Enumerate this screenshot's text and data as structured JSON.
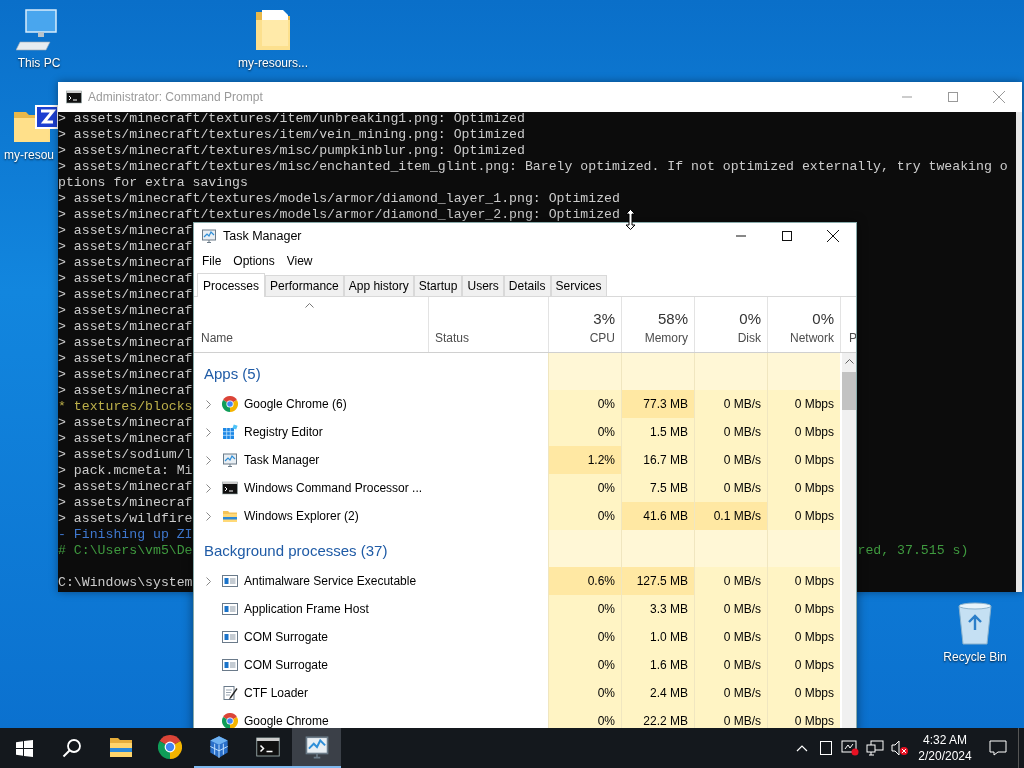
{
  "desktop_icons": [
    {
      "label": "This PC",
      "kind": "pc"
    },
    {
      "label": "my-resours...",
      "kind": "folder"
    },
    {
      "label": "my-resou",
      "kind": "zip"
    },
    {
      "label": "Recycle Bin",
      "kind": "recycle"
    }
  ],
  "console": {
    "title": "Administrator: Command Prompt",
    "lines": [
      {
        "kind": "output",
        "text": "> assets/minecraft/textures/item/unbreaking1.png: Optimized"
      },
      {
        "kind": "output",
        "text": "> assets/minecraft/textures/item/vein_mining.png: Optimized"
      },
      {
        "kind": "output",
        "text": "> assets/minecraft/textures/misc/pumpkinblur.png: Optimized"
      },
      {
        "kind": "output",
        "text": "> assets/minecraft/textures/misc/enchanted_item_glint.png: Barely optimized. If not optimized externally, try tweaking o"
      },
      {
        "kind": "output",
        "text": "ptions for extra savings"
      },
      {
        "kind": "output",
        "text": "> assets/minecraft/textures/models/armor/diamond_layer_1.png: Optimized"
      },
      {
        "kind": "output",
        "text": "> assets/minecraft/textures/models/armor/diamond_layer_2.png: Optimized"
      },
      {
        "kind": "output",
        "text": "> assets/minecraf"
      },
      {
        "kind": "output",
        "text": "> assets/minecraf"
      },
      {
        "kind": "output",
        "text": "> assets/minecraf"
      },
      {
        "kind": "output",
        "text": "> assets/minecraf"
      },
      {
        "kind": "output",
        "text": "> assets/minecraf"
      },
      {
        "kind": "output",
        "text": "> assets/minecraf"
      },
      {
        "kind": "output",
        "text": "> assets/minecraf"
      },
      {
        "kind": "output",
        "text": "> assets/minecraf"
      },
      {
        "kind": "output",
        "text": "> assets/minecraf"
      },
      {
        "kind": "output",
        "text": "> assets/minecraf"
      },
      {
        "kind": "output",
        "text": "> assets/minecraf"
      },
      {
        "kind": "warning",
        "text": "* textures/blocks"
      },
      {
        "kind": "output",
        "text": "> assets/minecraf"
      },
      {
        "kind": "output",
        "text": "> assets/minecraf"
      },
      {
        "kind": "output",
        "text": "> assets/sodium/l"
      },
      {
        "kind": "output",
        "text": "> pack.mcmeta: Mi"
      },
      {
        "kind": "output",
        "text": "> assets/minecraf"
      },
      {
        "kind": "output",
        "text": "> assets/minecraf"
      },
      {
        "kind": "output",
        "text": "> assets/wildfire"
      },
      {
        "kind": "info",
        "text": "- Finishing up ZI"
      },
      {
        "kind": "success",
        "text": "# C:\\Users\\vm5\\De",
        "tail": "red, 37.515 s)"
      },
      {
        "kind": "blank"
      },
      {
        "kind": "output",
        "text": "C:\\Windows\\system"
      }
    ]
  },
  "task_manager": {
    "title": "Task Manager",
    "menu": [
      "File",
      "Options",
      "View"
    ],
    "tabs": [
      {
        "label": "Processes",
        "selected": true
      },
      {
        "label": "Performance",
        "selected": false
      },
      {
        "label": "App history",
        "selected": false
      },
      {
        "label": "Startup",
        "selected": false
      },
      {
        "label": "Users",
        "selected": false
      },
      {
        "label": "Details",
        "selected": false
      },
      {
        "label": "Services",
        "selected": false
      }
    ],
    "columns": {
      "name": "Name",
      "status": "Status",
      "metrics": [
        {
          "percent": "3%",
          "label": "CPU"
        },
        {
          "percent": "58%",
          "label": "Memory"
        },
        {
          "percent": "0%",
          "label": "Disk"
        },
        {
          "percent": "0%",
          "label": "Network"
        }
      ],
      "cut_header": "P"
    },
    "groups": [
      {
        "title": "Apps (5)",
        "rows": [
          {
            "name": "Google Chrome (6)",
            "kind": "chrome",
            "expandable": true,
            "cells": [
              {
                "text": "0%",
                "hot": false
              },
              {
                "text": "77.3 MB",
                "hot": true
              },
              {
                "text": "0 MB/s",
                "hot": false
              },
              {
                "text": "0 Mbps",
                "hot": false
              }
            ]
          },
          {
            "name": "Registry Editor",
            "kind": "registry",
            "expandable": true,
            "cells": [
              {
                "text": "0%",
                "hot": false
              },
              {
                "text": "1.5 MB",
                "hot": false
              },
              {
                "text": "0 MB/s",
                "hot": false
              },
              {
                "text": "0 Mbps",
                "hot": false
              }
            ]
          },
          {
            "name": "Task Manager",
            "kind": "taskmgr",
            "expandable": true,
            "cells": [
              {
                "text": "1.2%",
                "hot": true
              },
              {
                "text": "16.7 MB",
                "hot": false
              },
              {
                "text": "0 MB/s",
                "hot": false
              },
              {
                "text": "0 Mbps",
                "hot": false
              }
            ]
          },
          {
            "name": "Windows Command Processor ...",
            "kind": "cmd",
            "expandable": true,
            "cells": [
              {
                "text": "0%",
                "hot": false
              },
              {
                "text": "7.5 MB",
                "hot": false
              },
              {
                "text": "0 MB/s",
                "hot": false
              },
              {
                "text": "0 Mbps",
                "hot": false
              }
            ]
          },
          {
            "name": "Windows Explorer (2)",
            "kind": "explorer",
            "expandable": true,
            "cells": [
              {
                "text": "0%",
                "hot": false
              },
              {
                "text": "41.6 MB",
                "hot": true
              },
              {
                "text": "0.1 MB/s",
                "hot": true
              },
              {
                "text": "0 Mbps",
                "hot": false
              }
            ]
          }
        ]
      },
      {
        "title": "Background processes (37)",
        "rows": [
          {
            "name": "Antimalware Service Executable",
            "kind": "service",
            "expandable": true,
            "cells": [
              {
                "text": "0.6%",
                "hot": true
              },
              {
                "text": "127.5 MB",
                "hot": true
              },
              {
                "text": "0 MB/s",
                "hot": false
              },
              {
                "text": "0 Mbps",
                "hot": false
              }
            ]
          },
          {
            "name": "Application Frame Host",
            "kind": "service",
            "expandable": false,
            "cells": [
              {
                "text": "0%",
                "hot": false
              },
              {
                "text": "3.3 MB",
                "hot": false
              },
              {
                "text": "0 MB/s",
                "hot": false
              },
              {
                "text": "0 Mbps",
                "hot": false
              }
            ]
          },
          {
            "name": "COM Surrogate",
            "kind": "service",
            "expandable": false,
            "cells": [
              {
                "text": "0%",
                "hot": false
              },
              {
                "text": "1.0 MB",
                "hot": false
              },
              {
                "text": "0 MB/s",
                "hot": false
              },
              {
                "text": "0 Mbps",
                "hot": false
              }
            ]
          },
          {
            "name": "COM Surrogate",
            "kind": "service",
            "expandable": false,
            "cells": [
              {
                "text": "0%",
                "hot": false
              },
              {
                "text": "1.6 MB",
                "hot": false
              },
              {
                "text": "0 MB/s",
                "hot": false
              },
              {
                "text": "0 Mbps",
                "hot": false
              }
            ]
          },
          {
            "name": "CTF Loader",
            "kind": "ctf",
            "expandable": false,
            "cells": [
              {
                "text": "0%",
                "hot": false
              },
              {
                "text": "2.4 MB",
                "hot": false
              },
              {
                "text": "0 MB/s",
                "hot": false
              },
              {
                "text": "0 Mbps",
                "hot": false
              }
            ]
          },
          {
            "name": "Google Chrome",
            "kind": "chrome",
            "expandable": false,
            "cells": [
              {
                "text": "0%",
                "hot": false
              },
              {
                "text": "22.2 MB",
                "hot": false
              },
              {
                "text": "0 MB/s",
                "hot": false
              },
              {
                "text": "0 Mbps",
                "hot": false
              }
            ]
          }
        ]
      }
    ]
  },
  "taskbar": {
    "apps": [
      {
        "kind": "explorer",
        "running": false,
        "selected": false
      },
      {
        "kind": "chrome",
        "running": false,
        "selected": false
      },
      {
        "kind": "blocks",
        "running": true,
        "selected": false
      },
      {
        "kind": "cmd",
        "running": true,
        "selected": false
      },
      {
        "kind": "taskmgr",
        "running": true,
        "selected": true
      }
    ],
    "clock": {
      "time": "4:32 AM",
      "date": "2/20/2024"
    }
  }
}
